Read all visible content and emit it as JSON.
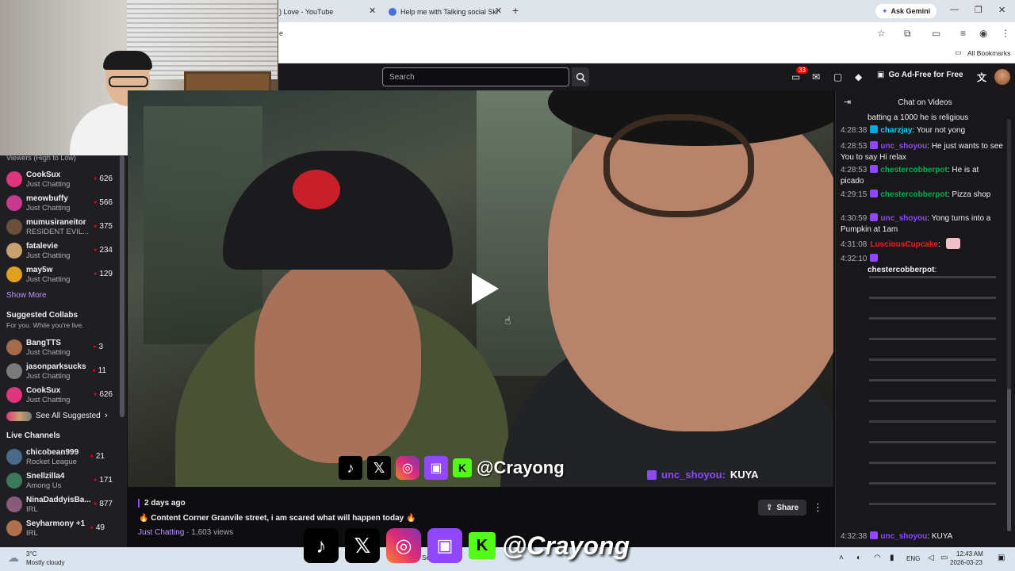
{
  "browser": {
    "tabs": [
      {
        "title": ") Love - YouTube"
      },
      {
        "title": "Help me with Talking social Ski"
      }
    ],
    "new_tab": "+",
    "ask_gemini": "Ask Gemini",
    "address_fragment": "e",
    "all_bookmarks": "All Bookmarks"
  },
  "twitch": {
    "search_placeholder": "Search",
    "notification_count": "33",
    "ad_free": "Go Ad-Free for Free"
  },
  "sidebar": {
    "viewers_header": "Viewers (High to Low)",
    "followed": [
      {
        "name": "CookSux",
        "category": "Just Chatting",
        "viewers": "626",
        "color": "#e0357d"
      },
      {
        "name": "meowbuffy",
        "category": "Just Chatting",
        "viewers": "566",
        "color": "#c53a8f"
      },
      {
        "name": "mumusiraneitor",
        "category": "RESIDENT EVIL...",
        "viewers": "375",
        "color": "#6a4f3b"
      },
      {
        "name": "fatalevie",
        "category": "Just Chatting",
        "viewers": "234",
        "color": "#c9a070"
      },
      {
        "name": "may5w",
        "category": "Just Chatting",
        "viewers": "129",
        "color": "#e0a020"
      }
    ],
    "show_more": "Show More",
    "suggested_collabs": "Suggested Collabs",
    "suggested_sub": "For you. While you're live.",
    "suggested": [
      {
        "name": "BangTTS",
        "category": "Just Chatting",
        "viewers": "3",
        "color": "#a36b4a"
      },
      {
        "name": "jasonparksucks",
        "category": "Just Chatting",
        "viewers": "11",
        "color": "#7a7a7a"
      },
      {
        "name": "CookSux",
        "category": "Just Chatting",
        "viewers": "626",
        "color": "#e0357d"
      }
    ],
    "see_all": "See All Suggested",
    "live_channels": "Live Channels",
    "live": [
      {
        "name": "chicobean999",
        "category": "Rocket League",
        "viewers": "21",
        "color": "#4a6a8a"
      },
      {
        "name": "Snellzilla4",
        "category": "Among Us",
        "viewers": "171",
        "color": "#3a7a5a"
      },
      {
        "name": "NinaDaddyisBa...",
        "category": "IRL",
        "viewers": "877",
        "color": "#8a5a7a"
      },
      {
        "name": "Seyharmony +1",
        "category": "IRL",
        "viewers": "49",
        "color": "#b07050"
      }
    ]
  },
  "video": {
    "handle": "@Crayong",
    "overlay_user": "unc_shoyou:",
    "overlay_msg": "KUYA",
    "date": "2 days ago",
    "title": "🔥 Content Corner Granvile street, i am scared what will happen today 🔥",
    "category": "Just Chatting",
    "views": " · 1,603 views",
    "share": "Share"
  },
  "chat": {
    "title": "Chat on Videos",
    "messages": [
      {
        "time": "",
        "user": "",
        "user_color": "#efeff1",
        "text": "batting a 1000 he is religious"
      },
      {
        "time": "4:28:38",
        "user": "charzjay",
        "user_color": "#00d5ff",
        "text": ": Your not yong"
      },
      {
        "time": "4:28:53",
        "user": "unc_shoyou",
        "user_color": "#9147ff",
        "text": ": He just wants to see You to say Hi relax"
      },
      {
        "time": "4:28:53",
        "user": "chestercobberpot",
        "user_color": "#00b050",
        "text": ": He is at picado"
      },
      {
        "time": "4:29:15",
        "user": "chestercobberpot",
        "user_color": "#00b050",
        "text": ": Pizza shop"
      },
      {
        "time": "4:30:59",
        "user": "unc_shoyou",
        "user_color": "#9147ff",
        "text": ": Yong turns into a Pumpkin at 1am"
      },
      {
        "time": "4:31:08",
        "user": "LusciousCupcake",
        "user_color": "#ff1a1a",
        "text": ":"
      },
      {
        "time": "4:32:10",
        "user": "chestercobberpot",
        "user_color": "#00b050",
        "text": ":"
      },
      {
        "time": "4:32:38",
        "user": "unc_shoyou",
        "user_color": "#9147ff",
        "text": ": KUYA"
      }
    ]
  },
  "taskbar": {
    "temp": "3°C",
    "weather": "Mostly cloudy",
    "search": "Search",
    "lang": "ENG",
    "time": "12:43 AM",
    "date": "2026-03-23"
  }
}
